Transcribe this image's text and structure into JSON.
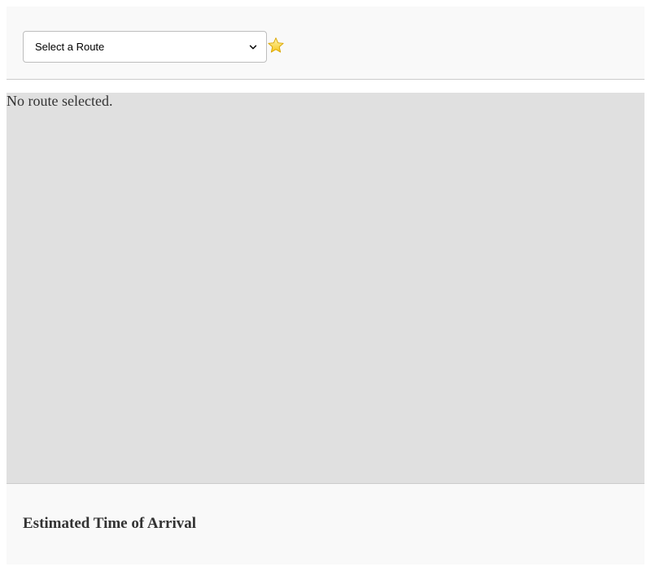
{
  "header": {
    "route_select": {
      "selected_label": "Select a Route"
    },
    "favorite_icon": "star-icon",
    "favorite_color": "#f5c518"
  },
  "map": {
    "status_text": "No route selected.",
    "background_color": "#e0e0e0"
  },
  "eta": {
    "title": "Estimated Time of Arrival"
  }
}
